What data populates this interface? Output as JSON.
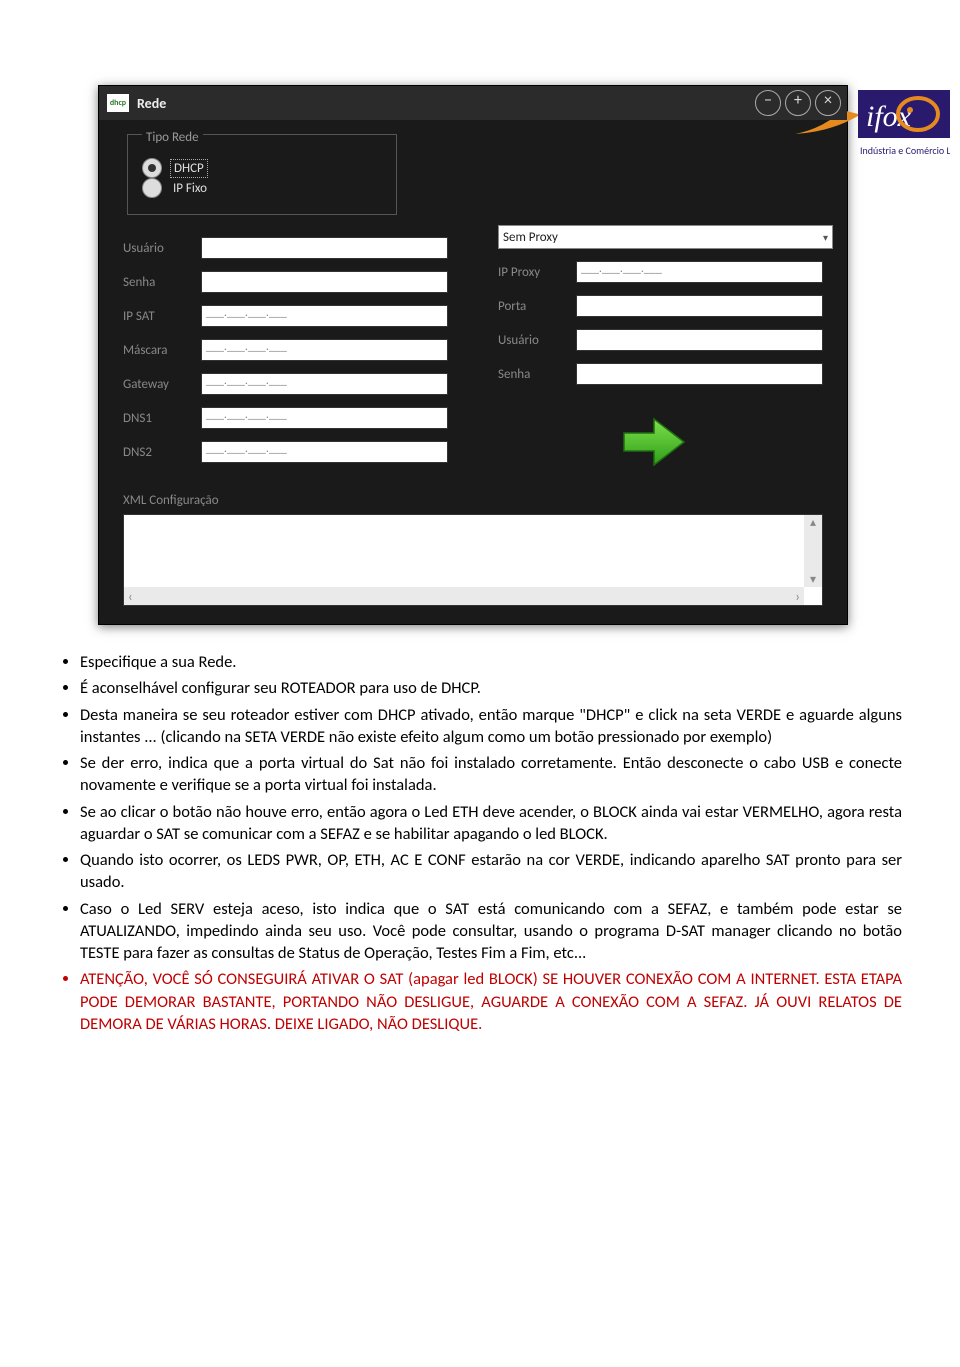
{
  "logo": {
    "brand": "ifox",
    "tagline": "Indústria e Comércio Ltda ME"
  },
  "window": {
    "title": "Rede",
    "app_icon_text": "dhcp",
    "buttons": {
      "minimize": "−",
      "maximize": "+",
      "close": "×"
    },
    "tipo_rede": {
      "legend": "Tipo Rede",
      "dhcp": "DHCP",
      "ipfixo": "IP Fixo"
    },
    "left": {
      "usuario": {
        "label": "Usuário",
        "value": ""
      },
      "senha": {
        "label": "Senha",
        "value": ""
      },
      "ipsat": {
        "label": "IP SAT",
        "value": "___.___.___.___"
      },
      "mascara": {
        "label": "Máscara",
        "value": "___.___.___.___"
      },
      "gateway": {
        "label": "Gateway",
        "value": "___.___.___.___"
      },
      "dns1": {
        "label": "DNS1",
        "value": "___.___.___.___"
      },
      "dns2": {
        "label": "DNS2",
        "value": "___.___.___.___"
      }
    },
    "right": {
      "proxy_select": "Sem Proxy",
      "ipproxy": {
        "label": "IP Proxy",
        "value": "___.___.___.___"
      },
      "porta": {
        "label": "Porta",
        "value": ""
      },
      "usuario": {
        "label": "Usuário",
        "value": ""
      },
      "senha": {
        "label": "Senha",
        "value": ""
      }
    },
    "xml_label": "XML Configuração"
  },
  "bullets": {
    "b1": "Especifique a sua Rede.",
    "b2": "É aconselhável configurar seu ROTEADOR para uso de DHCP.",
    "b3": "Desta maneira se seu roteador estiver com DHCP ativado, então marque \"DHCP\" e click na seta VERDE e aguarde alguns instantes ... (clicando na SETA VERDE não existe efeito algum como um botão pressionado por exemplo)",
    "b4": "Se der erro, indica que a porta virtual do Sat não foi instalado corretamente. Então desconecte o cabo USB e conecte novamente e verifique se a porta virtual foi instalada.",
    "b5": "Se ao clicar o botão não houve erro, então agora o Led ETH deve acender, o BLOCK ainda vai estar VERMELHO, agora resta aguardar o SAT se comunicar com a SEFAZ  e se habilitar apagando o led BLOCK.",
    "b6": "Quando isto ocorrer, os LEDS PWR, OP, ETH,  AC E CONF estarão na cor VERDE, indicando aparelho SAT pronto para ser usado.",
    "b7": "Caso o Led SERV esteja aceso, isto indica que o SAT está comunicando com a SEFAZ, e também pode estar se ATUALIZANDO, impedindo ainda seu uso. Você pode consultar, usando o programa D-SAT manager clicando no botão TESTE para fazer as consultas de Status de Operação, Testes Fim a Fim, etc...",
    "b8": "ATENÇÃO, VOCÊ SÓ CONSEGUIRÁ ATIVAR O SAT  (apagar led BLOCK) SE HOUVER CONEXÃO COM A INTERNET. ESTA ETAPA PODE DEMORAR BASTANTE, PORTANDO NÃO DESLIGUE, AGUARDE A CONEXÃO COM A SEFAZ. JÁ OUVI RELATOS DE DEMORA DE VÁRIAS HORAS. DEIXE LIGADO, NÃO DESLIQUE."
  }
}
